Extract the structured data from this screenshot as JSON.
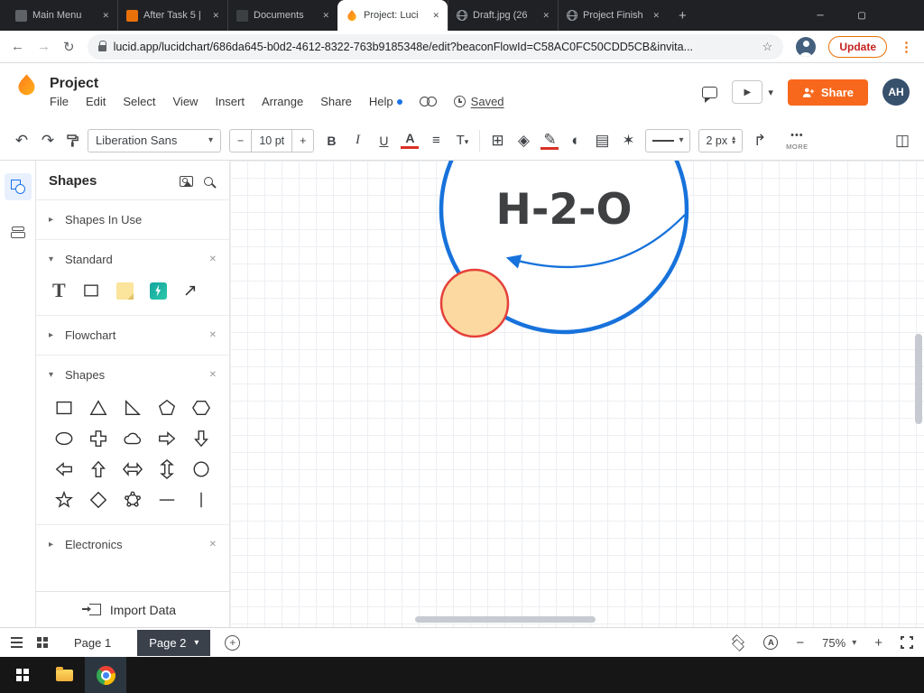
{
  "browser": {
    "tabs": [
      {
        "label": "Main Menu"
      },
      {
        "label": "After Task 5 |"
      },
      {
        "label": "Documents"
      },
      {
        "label": "Project: Luci"
      },
      {
        "label": "Draft.jpg (26"
      },
      {
        "label": "Project Finish"
      }
    ],
    "url": "lucid.app/lucidchart/686da645-b0d2-4612-8322-763b9185348e/edit?beaconFlowId=C58AC0FC50CDD5CB&invita...",
    "update_label": "Update"
  },
  "app": {
    "doc_title": "Project",
    "menus": [
      "File",
      "Edit",
      "Select",
      "View",
      "Insert",
      "Arrange",
      "Share",
      "Help"
    ],
    "saved": "Saved",
    "share": "Share",
    "avatar": "AH"
  },
  "toolbar": {
    "font_name": "Liberation Sans",
    "font_size": "10 pt",
    "bold": "B",
    "italic": "I",
    "underline": "U",
    "text_color": "A",
    "text_style": "T",
    "line_weight": "2 px",
    "more": "MORE"
  },
  "sidebar": {
    "title": "Shapes",
    "sections": {
      "in_use": "Shapes In Use",
      "standard": "Standard",
      "flowchart": "Flowchart",
      "shapes": "Shapes",
      "electronics": "Electronics"
    },
    "standard_text_glyph": "T",
    "shape_names": [
      "square",
      "triangle",
      "right-triangle",
      "pentagon",
      "hexagon",
      "ellipse",
      "cross",
      "cloud",
      "arrow-right",
      "arrow-down",
      "arrow-left",
      "arrow-up",
      "arrow-left-right",
      "arrow-up-down",
      "circle",
      "star",
      "diamond",
      "polygon",
      "line",
      "vertical-line"
    ],
    "import_label": "Import Data"
  },
  "canvas": {
    "node_text": "H-2-O"
  },
  "statusbar": {
    "page1": "Page 1",
    "page2": "Page 2",
    "zoom": "75%"
  },
  "colors": {
    "lucid_orange": "#f7681c",
    "circle_stroke_blue": "#1772db",
    "ellipse_fill": "#fbd9a0",
    "ellipse_stroke": "#e5403a",
    "active_page_bg": "#3a414b"
  },
  "icons": {
    "close_x": "✕",
    "min": "─",
    "max": "▢",
    "plus": "+",
    "minus": "−",
    "back": "←",
    "forward": "→",
    "reload": "↻",
    "star": "☆",
    "kebab": "⋮",
    "undo": "↶",
    "redo": "↷",
    "caret": "▾",
    "chev_right": "▸",
    "chev_down": "▾",
    "align": "≡",
    "shape_add": "⊞",
    "fill": "◈",
    "pen": "✎",
    "ink": "◐",
    "stamp": "▤",
    "wand": "✶",
    "connector": "↱",
    "panel": "◫",
    "play": "▶",
    "dots": "•••",
    "tri_up": "▴",
    "tri_down": "▾",
    "arrow_ne": "↗",
    "spell": "A"
  }
}
